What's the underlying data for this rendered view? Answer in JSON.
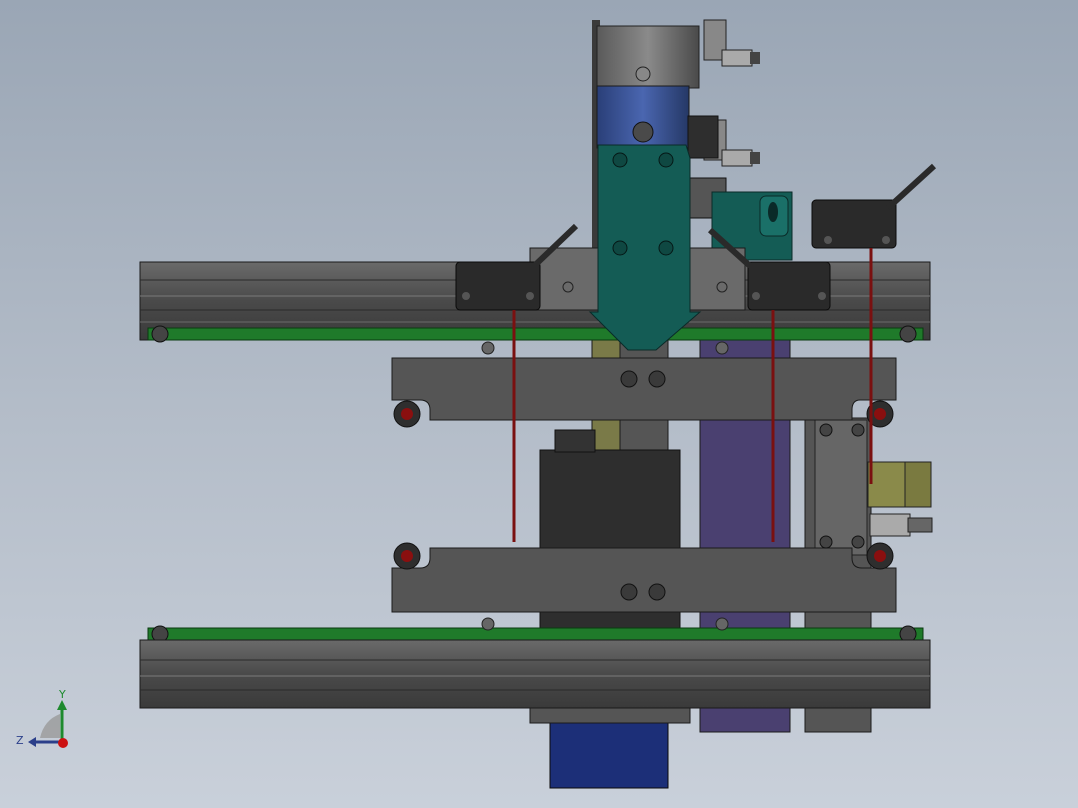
{
  "viewport": {
    "background_top": "#9aa6b5",
    "background_bottom": "#c9d0da"
  },
  "colors": {
    "frame": "#4a4a4a",
    "frame_dark": "#2e2e2e",
    "belt_green": "#1f7a2a",
    "carriage_teal": "#145c55",
    "cylinder_blue": "#2f4a8a",
    "motor_blue": "#1c2f78",
    "purple_block": "#4a4070",
    "bolt_red": "#8a0f0f",
    "wire_red": "#7a1010",
    "olive": "#8a8a4a"
  },
  "triad": {
    "y_label": "Y",
    "z_label": "Z",
    "y_axis_color": "#1e8a2e",
    "z_axis_color": "#2b3f8a",
    "origin_color": "#cc1111"
  }
}
